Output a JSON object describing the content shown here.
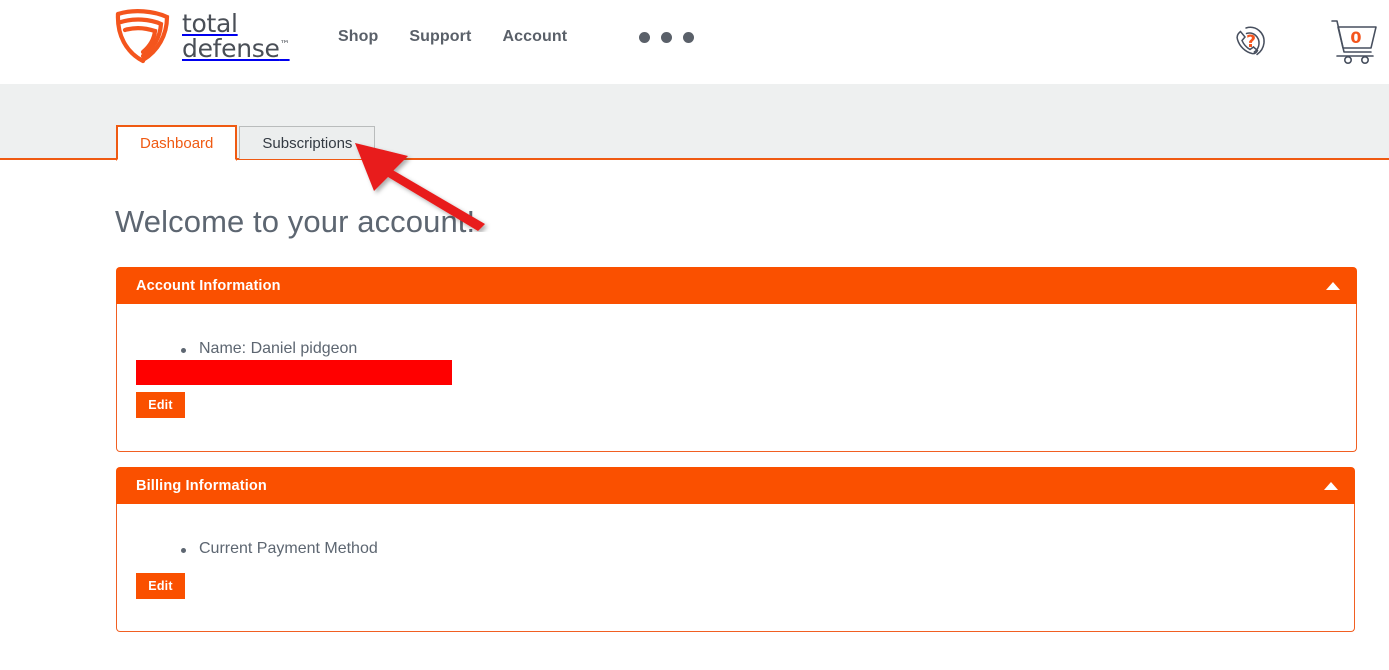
{
  "header": {
    "logo": {
      "icon": "shield-swoosh-logo",
      "line1": "total",
      "line2": "defense",
      "trademark": "™"
    },
    "nav": [
      {
        "label": "Shop"
      },
      {
        "label": "Support"
      },
      {
        "label": "Account"
      }
    ],
    "overflow_menu": {
      "icon": "three-dots-icon",
      "dots": 3
    },
    "help": {
      "icon": "phone-question-help-icon",
      "symbol": "?"
    },
    "cart": {
      "icon": "shopping-cart-icon",
      "count": "0"
    }
  },
  "tabs": [
    {
      "label": "Dashboard",
      "active": true
    },
    {
      "label": "Subscriptions",
      "active": false
    }
  ],
  "main": {
    "title": "Welcome to your account!",
    "panels": [
      {
        "title": "Account Information",
        "collapse_icon": "caret-up-icon",
        "items": [
          "Name: Daniel pidgeon"
        ],
        "redacted": true,
        "edit_label": "Edit"
      },
      {
        "title": "Billing Information",
        "collapse_icon": "caret-up-icon",
        "items": [
          "Current Payment Method"
        ],
        "redacted": false,
        "edit_label": "Edit"
      }
    ]
  },
  "annotation": {
    "type": "arrow",
    "color": "#e81c1c",
    "points_to": "Subscriptions"
  },
  "colors": {
    "brand_orange": "#fa5000",
    "tab_orange": "#ef5a12",
    "nav_gray": "#5a6069",
    "text_gray": "#5d6671",
    "band_gray": "#eef0f0",
    "redaction_red": "#ff0000",
    "annotation_red": "#e81c1c"
  }
}
